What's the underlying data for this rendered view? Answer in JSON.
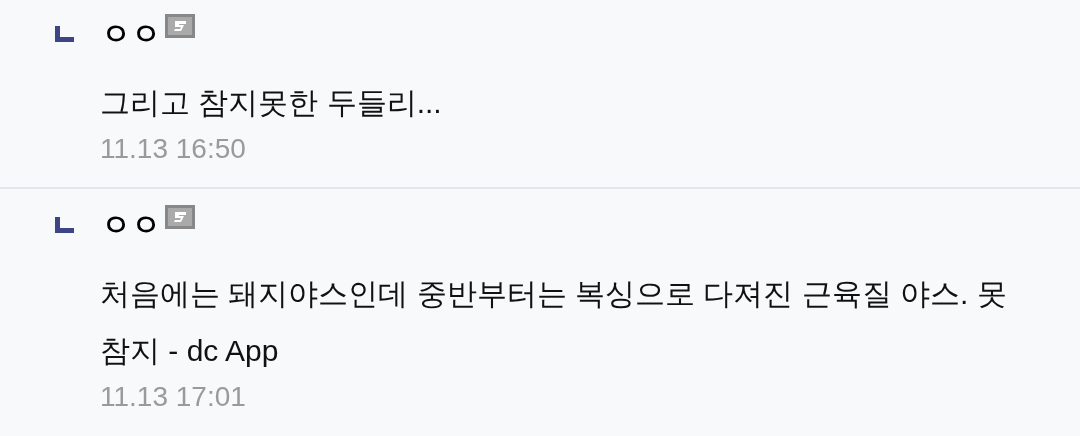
{
  "comments": [
    {
      "author": "ㅇㅇ",
      "text": "그리고 참지못한 두들리...",
      "time": "11.13 16:50"
    },
    {
      "author": "ㅇㅇ",
      "text": "처음에는 돼지야스인데 중반부터는 복싱으로 다져진 근육질 야스. 못참지 - dc App",
      "time": "11.13 17:01"
    }
  ]
}
